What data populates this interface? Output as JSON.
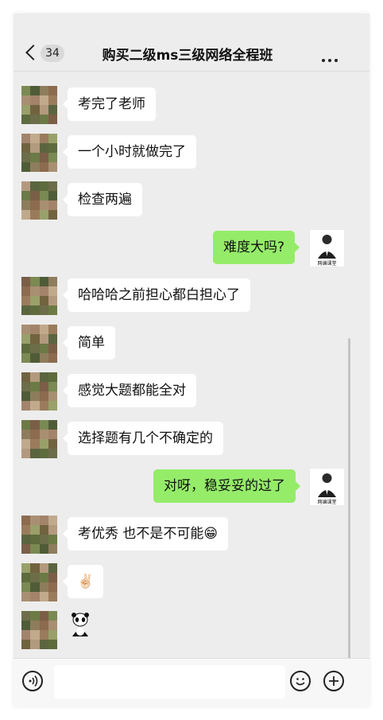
{
  "header": {
    "unread_count": "34",
    "title": "购买二级ms三级网络全程班",
    "back_icon": "chevron-left-icon",
    "more_icon": "more-dots-icon"
  },
  "avatar_brand_text": "网编课堂",
  "colors": {
    "background": "#ededed",
    "incoming_bubble": "#ffffff",
    "outgoing_bubble": "#95ec69"
  },
  "messages": [
    {
      "side": "left",
      "text": "考完了老师"
    },
    {
      "side": "left",
      "text": "一个小时就做完了"
    },
    {
      "side": "left",
      "text": "检查两遍"
    },
    {
      "side": "right",
      "text": "难度大吗?"
    },
    {
      "side": "left",
      "text": "哈哈哈之前担心都白担心了"
    },
    {
      "side": "left",
      "text": "简单"
    },
    {
      "side": "left",
      "text": "感觉大题都能全对"
    },
    {
      "side": "left",
      "text": "选择题有几个不确定的"
    },
    {
      "side": "right",
      "text": "对呀，稳妥妥的过了"
    },
    {
      "side": "left",
      "text": "考优秀 也不是不可能😁"
    },
    {
      "side": "left",
      "text": "✌🏻"
    },
    {
      "side": "left",
      "sticker": "panda-sticker-icon"
    }
  ],
  "input_bar": {
    "voice_icon": "voice-icon",
    "emoji_icon": "emoji-icon",
    "plus_icon": "plus-icon"
  }
}
